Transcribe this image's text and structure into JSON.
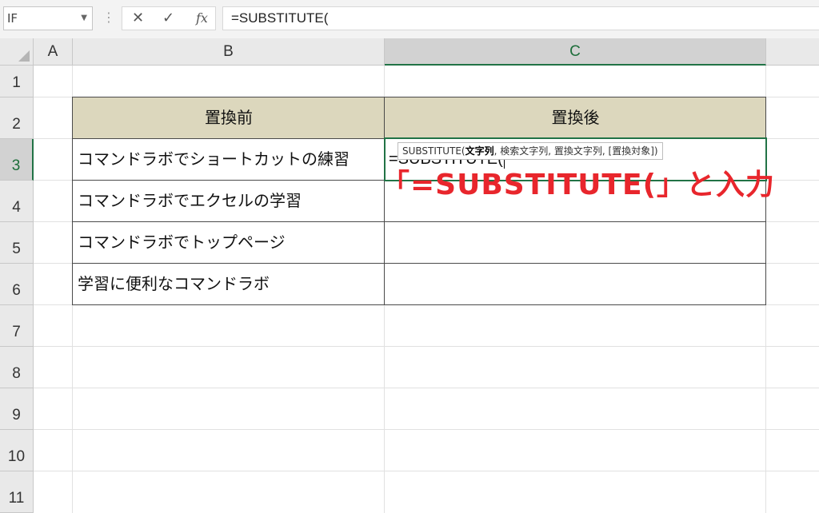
{
  "formula_bar": {
    "name_box": "IF",
    "cancel_icon": "✕",
    "enter_icon": "✓",
    "fx_label": "fx",
    "formula": "=SUBSTITUTE("
  },
  "columns": [
    "A",
    "B",
    "C"
  ],
  "rows": [
    "1",
    "2",
    "3",
    "4",
    "5",
    "6",
    "7",
    "8",
    "9",
    "10",
    "11"
  ],
  "table": {
    "header_before": "置換前",
    "header_after": "置換後",
    "b3": "コマンドラボでショートカットの練習",
    "b4": "コマンドラボでエクセルの学習",
    "b5": "コマンドラボでトップページ",
    "b6": "学習に便利なコマンドラボ",
    "c3": "=SUBSTITUTE("
  },
  "tooltip": {
    "prefix": "SUBSTITUTE(",
    "bold_arg": "文字列",
    "rest": ", 検索文字列, 置換文字列, [置換対象])"
  },
  "annotation": "「=SUBSTITUTE(」と入力",
  "colors": {
    "selection": "#217346",
    "header_fill": "#dcd7bd",
    "annotation": "#e8262c"
  }
}
